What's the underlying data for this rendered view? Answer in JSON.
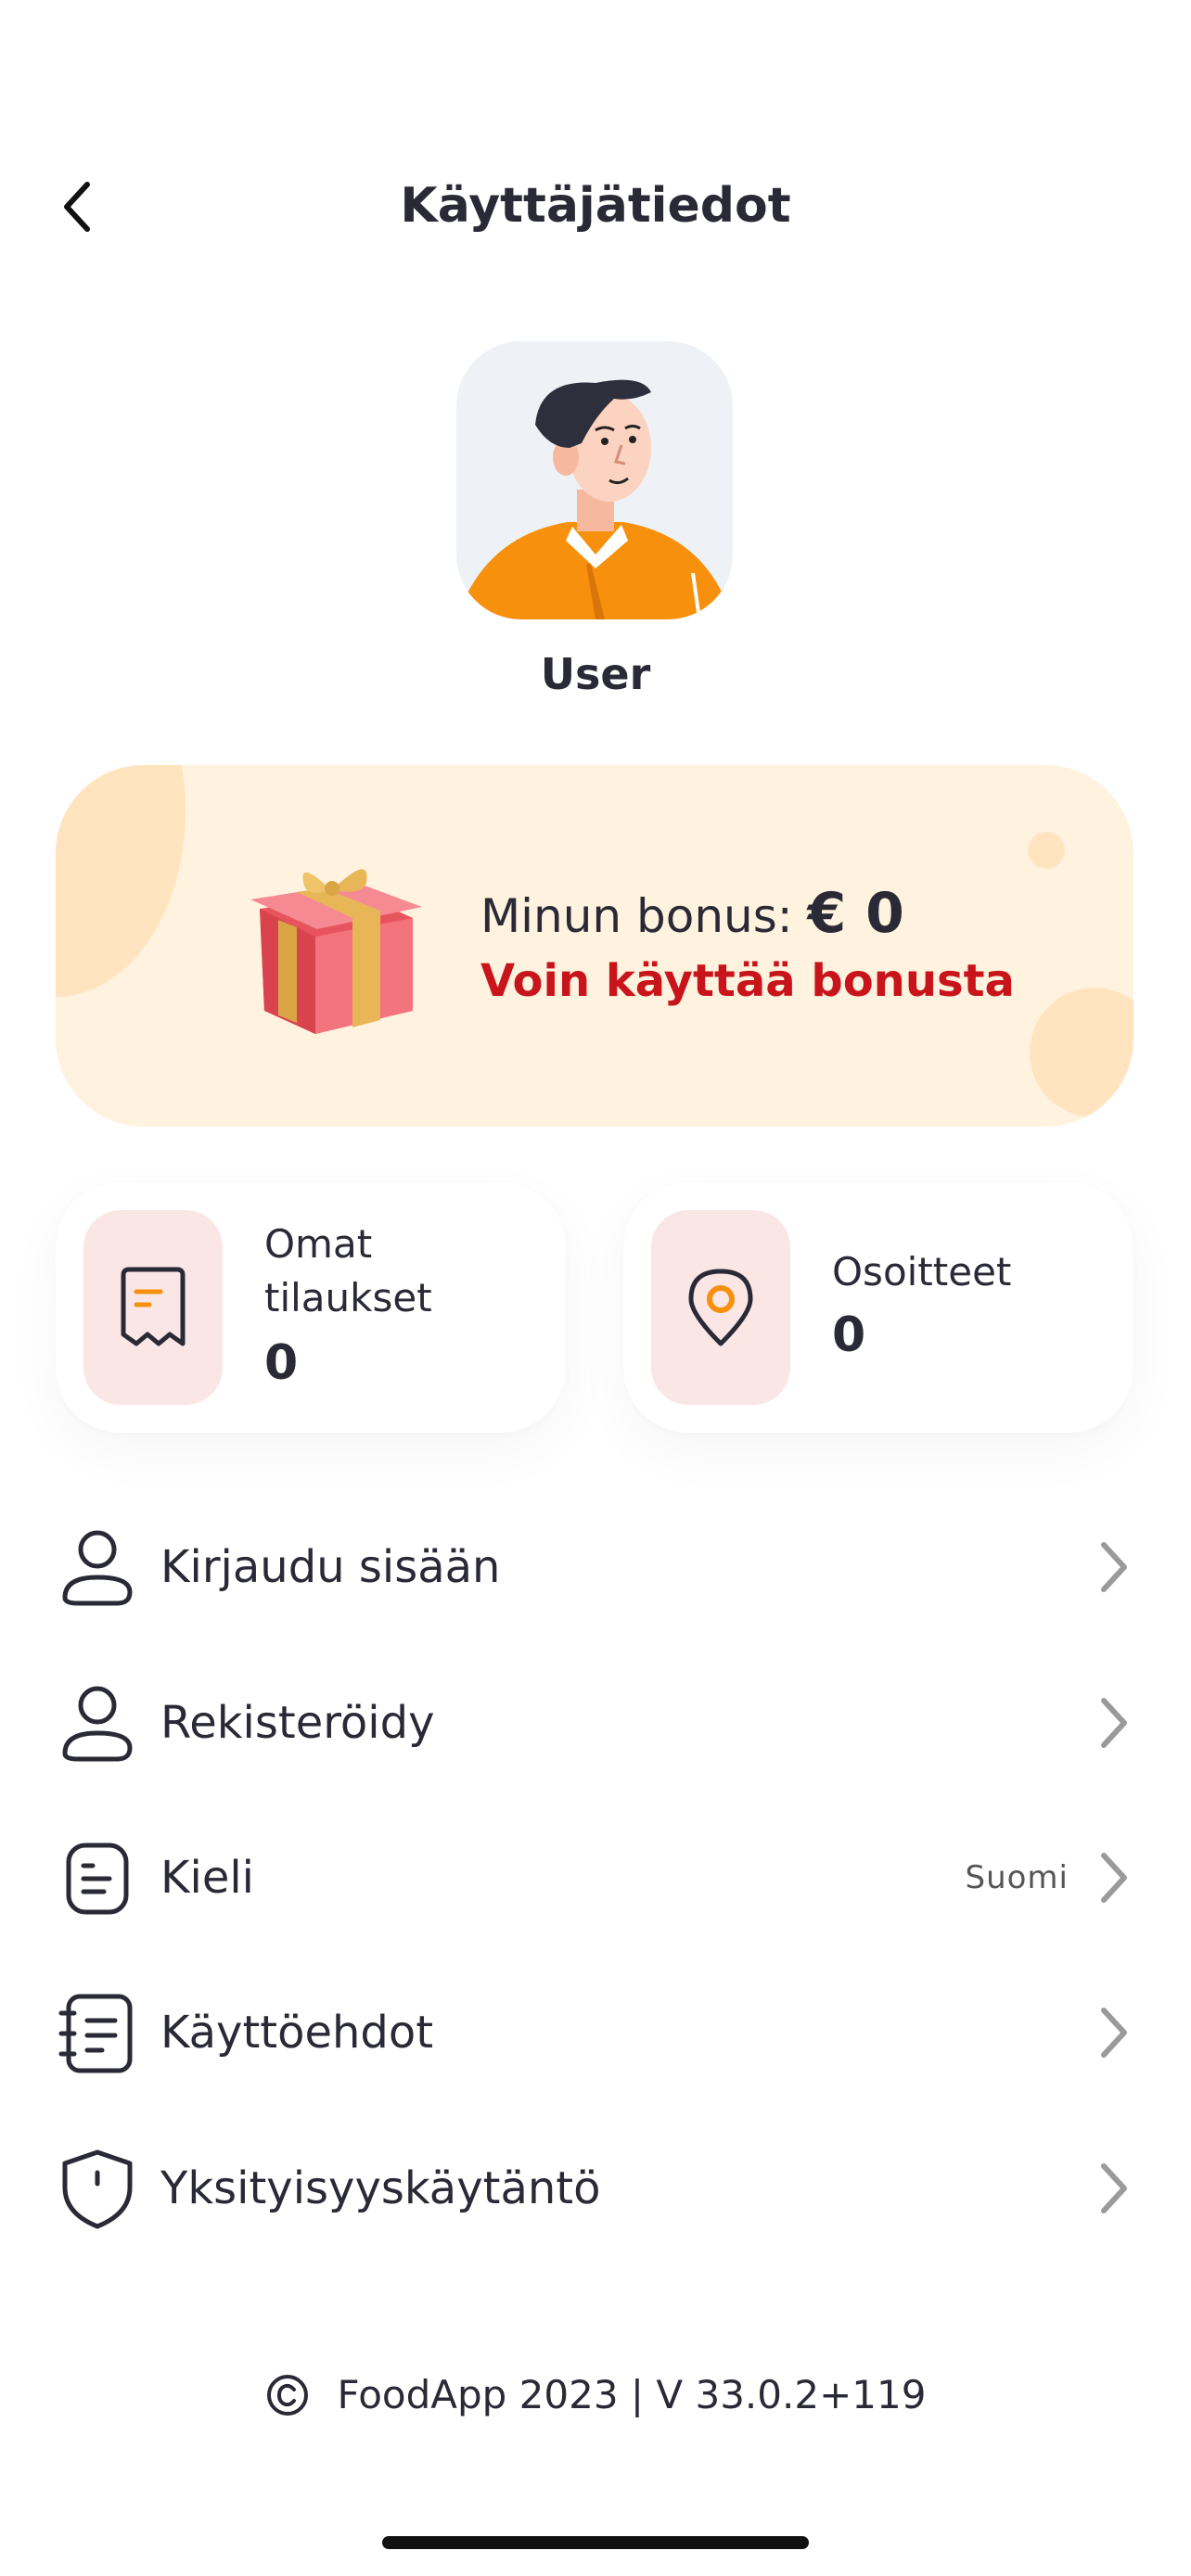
{
  "header": {
    "title": "Käyttäjätiedot",
    "back_icon": "chevron-left-icon"
  },
  "profile": {
    "name": "User",
    "avatar": "avatar-illustration"
  },
  "bonus": {
    "label": "Minun bonus:",
    "amount": "€ 0",
    "cta": "Voin käyttää bonusta",
    "icon": "gift-icon",
    "colors": {
      "background": "#fff2df",
      "cta": "#c8141b"
    }
  },
  "stats": {
    "orders": {
      "label": "Omat tilaukset",
      "value": "0",
      "icon": "receipt-icon"
    },
    "addresses": {
      "label": "Osoitteet",
      "value": "0",
      "icon": "location-pin-icon"
    }
  },
  "menu": {
    "login": {
      "label": "Kirjaudu sisään",
      "icon": "user-icon"
    },
    "register": {
      "label": "Rekisteröidy",
      "icon": "user-icon"
    },
    "language": {
      "label": "Kieli",
      "value": "Suomi",
      "icon": "document-icon"
    },
    "terms": {
      "label": "Käyttöehdot",
      "icon": "notebook-icon"
    },
    "privacy": {
      "label": "Yksityisyyskäytäntö",
      "icon": "shield-icon"
    }
  },
  "footer": {
    "text": "FoodApp 2023 | V 33.0.2+119",
    "icon": "copyright-icon"
  }
}
